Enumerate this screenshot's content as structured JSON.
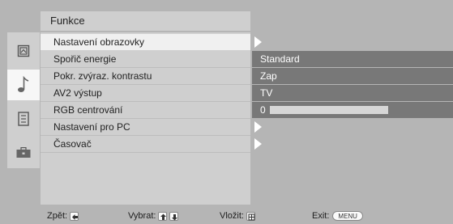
{
  "header": {
    "title": "Funkce"
  },
  "sidebar": {
    "icons": [
      {
        "name": "picture-icon",
        "active": false
      },
      {
        "name": "sound-icon",
        "active": true
      },
      {
        "name": "channel-setup-icon",
        "active": false
      },
      {
        "name": "features-toolbox-icon",
        "active": false
      }
    ]
  },
  "menu": {
    "items": [
      {
        "label": "Nastavení obrazovky",
        "selected": true,
        "submenu": true,
        "value": null
      },
      {
        "label": "Spořič energie",
        "selected": false,
        "submenu": false,
        "value": "Standard"
      },
      {
        "label": "Pokr. zvýraz. kontrastu",
        "selected": false,
        "submenu": false,
        "value": "Zap"
      },
      {
        "label": "AV2 výstup",
        "selected": false,
        "submenu": false,
        "value": "TV"
      },
      {
        "label": "RGB centrování",
        "selected": false,
        "submenu": false,
        "value": "0",
        "slider": true,
        "slider_level": 0
      },
      {
        "label": "Nastavení pro PC",
        "selected": false,
        "submenu": true,
        "value": null
      },
      {
        "label": "Časovač",
        "selected": false,
        "submenu": true,
        "value": null
      }
    ]
  },
  "footer": {
    "back_label": "Zpět:",
    "select_label": "Vybrat:",
    "enter_label": "Vložit:",
    "exit_label": "Exit:",
    "menu_key": "MENU"
  },
  "colors": {
    "panel": "#cfcfcf",
    "selected_row": "#f0f0f0",
    "value_cell": "#787878",
    "background": "#b5b5b5"
  }
}
